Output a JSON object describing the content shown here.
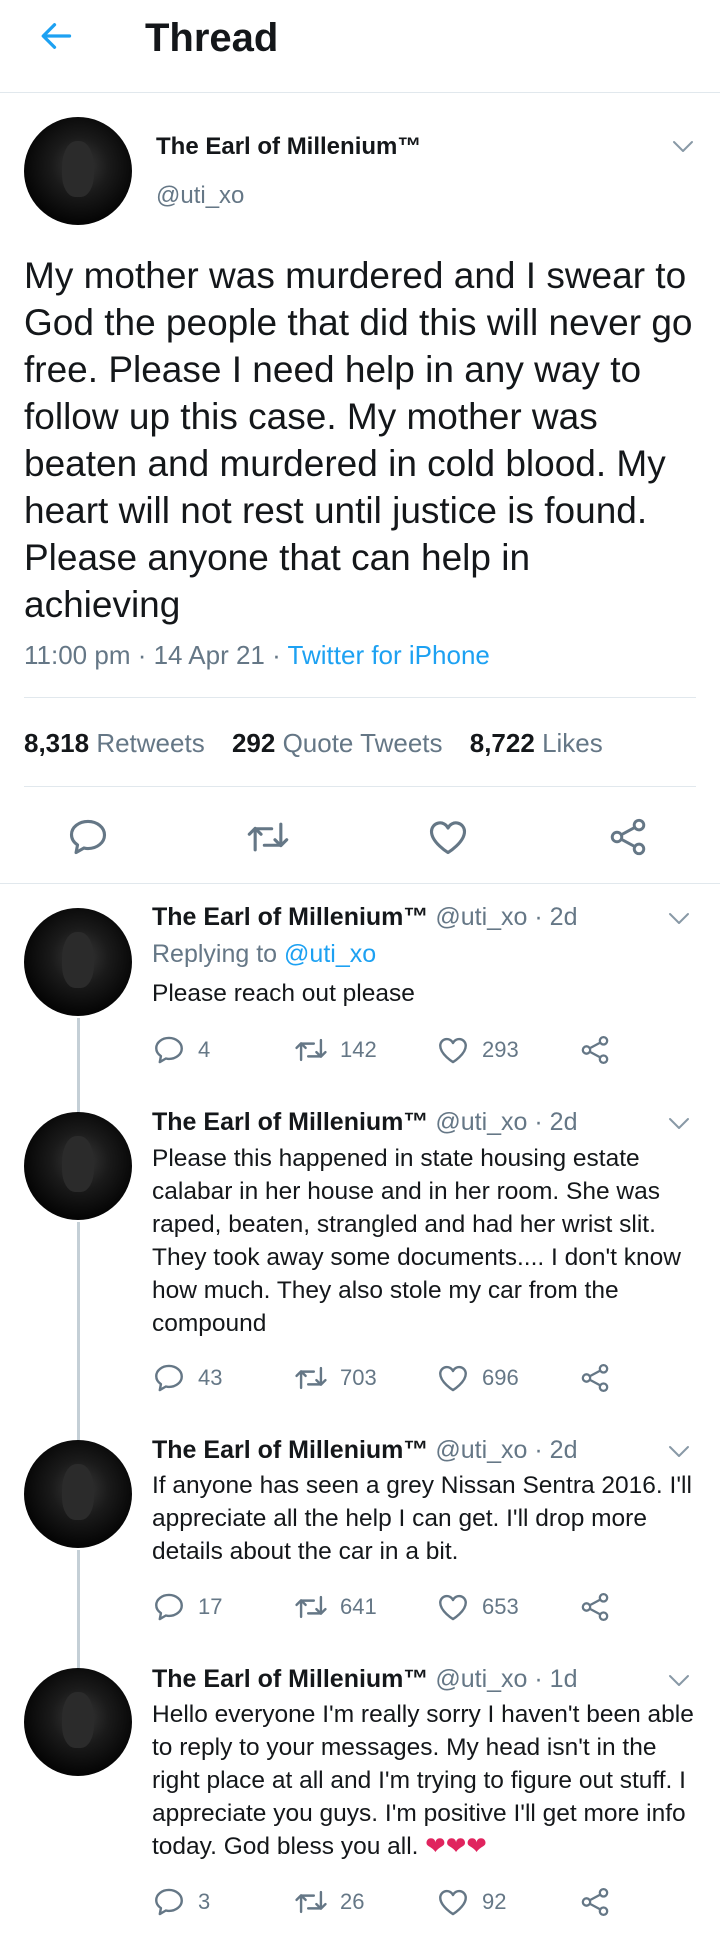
{
  "header": {
    "title": "Thread"
  },
  "tweet": {
    "author_name": "The Earl of Millenium™",
    "author_handle": "@uti_xo",
    "text": "My mother was murdered and I swear to God the people that did this will never go free. Please I need help in any way to follow up this case. My mother was beaten and murdered in cold blood. My heart will not rest until justice is found. Please anyone that can help in achieving",
    "time": "11:00 pm · 14 Apr 21 ·",
    "source": "Twitter for iPhone",
    "retweets_count": "8,318",
    "retweets_label": "Retweets",
    "quotes_count": "292",
    "quotes_label": "Quote Tweets",
    "likes_count": "8,722",
    "likes_label": "Likes"
  },
  "replies": [
    {
      "name": "The Earl of Millenium™",
      "meta": "@uti_xo · 2d",
      "replying_prefix": "Replying to",
      "replying_handle": "@uti_xo",
      "text": "Please reach out please",
      "comments": "4",
      "retweets": "142",
      "likes": "293"
    },
    {
      "name": "The Earl of Millenium™",
      "meta": "@uti_xo · 2d",
      "text": "Please this happened in state housing estate calabar in her house and in her room. She was raped, beaten, strangled and had her wrist slit. They took away some documents.... I don't know how much. They also stole my car from the compound",
      "comments": "43",
      "retweets": "703",
      "likes": "696"
    },
    {
      "name": "The Earl of Millenium™",
      "meta": "@uti_xo · 2d",
      "text": "If anyone has seen a grey Nissan Sentra 2016. I'll appreciate all the help I can get. I'll drop more details about the car in a bit.",
      "comments": "17",
      "retweets": "641",
      "likes": "653"
    },
    {
      "name": "The Earl of Millenium™",
      "meta": "@uti_xo · 1d",
      "text": "Hello everyone I'm really sorry I haven't been able to reply to your messages. My head isn't in the right place at all and I'm trying to figure out stuff. I appreciate you guys. I'm positive I'll get more info today. God bless you all.",
      "emoji": "❤❤❤",
      "comments": "3",
      "retweets": "26",
      "likes": "92"
    }
  ],
  "colors": {
    "accent": "#1da1f2",
    "muted": "#657786",
    "text": "#14171a",
    "divider": "#e1e8ed",
    "thread_line": "#c4cfd6",
    "heart": "#e0245e"
  },
  "icons": [
    "back-arrow-icon",
    "chevron-down-icon",
    "comment-icon",
    "retweet-icon",
    "like-icon",
    "share-icon"
  ]
}
